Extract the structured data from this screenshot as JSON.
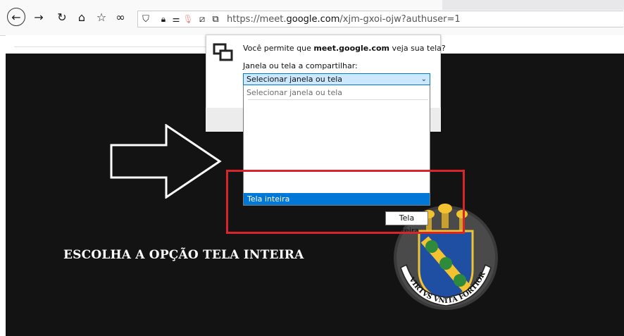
{
  "browser": {
    "url_prefix": "https://meet.",
    "url_domain": "google.com",
    "url_path": "/xjm-gxoi-ojw?authuser=1",
    "toolbar_icons": [
      "back-icon",
      "forward-icon",
      "reload-icon",
      "home-icon",
      "bookmarks-icon",
      "infinity-icon",
      "shield-icon",
      "lock-icon",
      "permissions-icon",
      "microphone-icon",
      "screen-share-blocked-icon",
      "window-share-icon"
    ]
  },
  "dialog": {
    "prompt_prefix": "Você permite que ",
    "prompt_domain": "meet.google.com",
    "prompt_suffix": " veja sua tela?",
    "label_first_letter": "J",
    "label_rest": "anela ou tela a compartilhar:",
    "select_value": "Selecionar janela ou tela",
    "list_placeholder": "Selecionar janela ou tela",
    "list_selected": "Tela inteira",
    "tooltip": "Tela inteira"
  },
  "page": {
    "instruction": "ESCOLHA A OPÇÃO TELA INTEIRA",
    "seal_motto": "VIRTVS VNITA FORTIOR"
  },
  "colors": {
    "highlight": "#d9242b",
    "selection": "#0078d7",
    "page_background": "#131313"
  }
}
